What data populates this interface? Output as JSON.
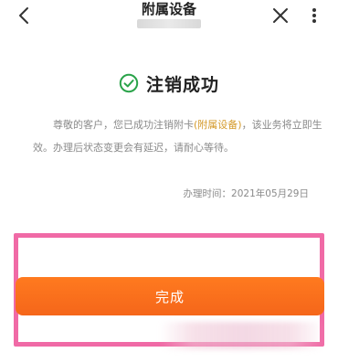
{
  "navbar": {
    "title": "附属设备",
    "back_icon": "chevron-left-icon",
    "close_icon": "close-icon",
    "more_icon": "more-vertical-icon"
  },
  "status": {
    "icon": "check-circle-icon",
    "title": "注销成功",
    "icon_color": "#2aa34a"
  },
  "message": {
    "before": "尊敬的客户，您已成功注销附卡",
    "highlight": "(附属设备)",
    "after": "，该业务将立即生效。办理后状态变更会有延迟，请耐心等待。",
    "highlight_color": "#d49a2a"
  },
  "time": {
    "text": "办理时间：2021年05月29日"
  },
  "actions": {
    "done_label": "完成",
    "button_color": "#f5661a"
  },
  "annotation": {
    "frame_color": "#f06aa6"
  }
}
